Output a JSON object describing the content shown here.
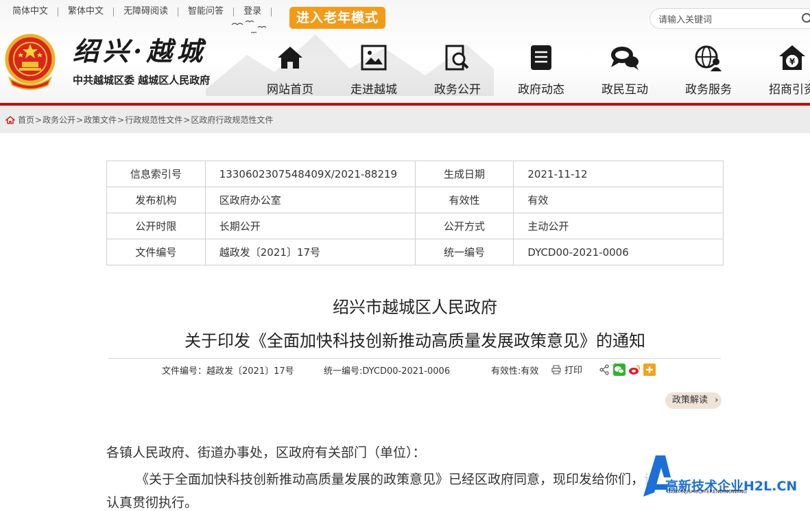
{
  "topbar": {
    "links": [
      "简体中文",
      "繁体中文",
      "无障碍阅读",
      "智能问答",
      "登录"
    ],
    "elder_mode": "进入老年模式"
  },
  "search": {
    "placeholder": "请输入关键词"
  },
  "logo": {
    "calligraphy": "绍兴·越城",
    "subtitle": "中共越城区委  越城区人民政府"
  },
  "nav": {
    "items": [
      {
        "label": "网站首页",
        "icon": "home-icon"
      },
      {
        "label": "走进越城",
        "icon": "picture-icon"
      },
      {
        "label": "政务公开",
        "icon": "search-doc-icon"
      },
      {
        "label": "政府动态",
        "icon": "document-icon"
      },
      {
        "label": "政民互动",
        "icon": "chat-icon"
      },
      {
        "label": "政务服务",
        "icon": "globe-person-icon"
      },
      {
        "label": "招商引资",
        "icon": "yen-house-icon"
      }
    ]
  },
  "breadcrumb": [
    "首页",
    "政务公开",
    "政策文件",
    "行政规范性文件",
    "区政府行政规范性文件"
  ],
  "info": {
    "rows": [
      {
        "k1": "信息索引号",
        "v1": "1330602307548409X/2021-88219",
        "k2": "生成日期",
        "v2": "2021-11-12"
      },
      {
        "k1": "发布机构",
        "v1": "区政府办公室",
        "k2": "有效性",
        "v2": "有效"
      },
      {
        "k1": "公开时限",
        "v1": "长期公开",
        "k2": "公开方式",
        "v2": "主动公开"
      },
      {
        "k1": "文件编号",
        "v1": "越政发〔2021〕17号",
        "k2": "统一编号",
        "v2": "DYCD00-2021-0006"
      }
    ]
  },
  "article": {
    "title_line1": "绍兴市越城区人民政府",
    "title_line2": "关于印发《全面加快科技创新推动高质量发展政策意见》的通知",
    "meta_doc_no": "文件编号：越政发〔2021〕17号",
    "meta_unified_no": "统一编号:DYCD00-2021-0006",
    "meta_validity": "有效性:有效",
    "print_label": "打印",
    "policy_interpret": "政策解读",
    "para1": "各镇人民政府、街道办事处，区政府有关部门（单位）：",
    "para2": "《关于全面加快科技创新推动高质量发展的政策意见》已经区政府同意，现印发给你们，请",
    "para3": "认真贯彻执行。"
  },
  "watermark": {
    "text": "高新技术企业H2L.CN",
    "sub": "GAOXINJISHUQIYERENDINGWANG"
  },
  "colors": {
    "accent_red": "#c40c0c",
    "elder_orange": "#f29b19",
    "breadcrumb_bg": "#ececec",
    "policy_btn_bg": "#efe3d9"
  }
}
